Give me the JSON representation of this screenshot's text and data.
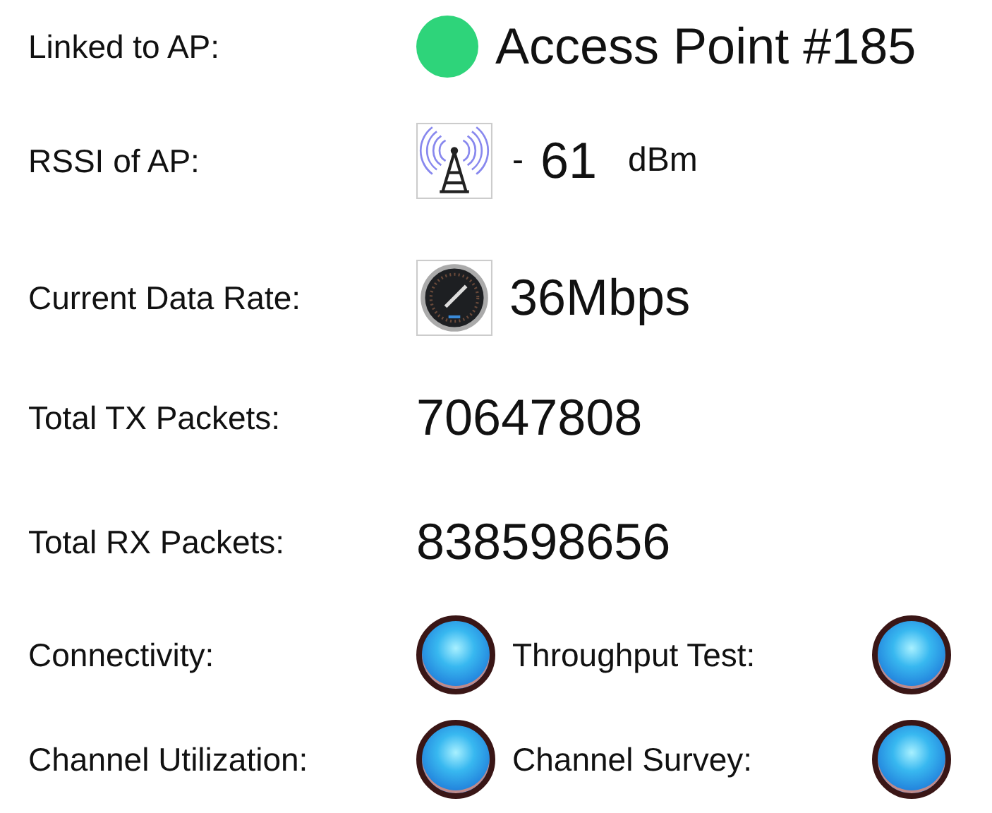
{
  "link": {
    "label": "Linked to AP:",
    "color": "#2ed47a",
    "value": "Access Point #185"
  },
  "rssi": {
    "label": "RSSI of AP:",
    "sign": "-",
    "value": "61",
    "unit": "dBm"
  },
  "rate": {
    "label": "Current Data Rate:",
    "value": "36Mbps"
  },
  "counters": [
    {
      "label": "Total TX Packets:",
      "value": "70647808"
    },
    {
      "label": "Total RX Packets:",
      "value": "838598656"
    }
  ],
  "indicators": [
    {
      "label": "Connectivity:"
    },
    {
      "label": "Throughput Test:"
    },
    {
      "label": "Channel Utilization:"
    },
    {
      "label": "Channel Survey:"
    }
  ]
}
